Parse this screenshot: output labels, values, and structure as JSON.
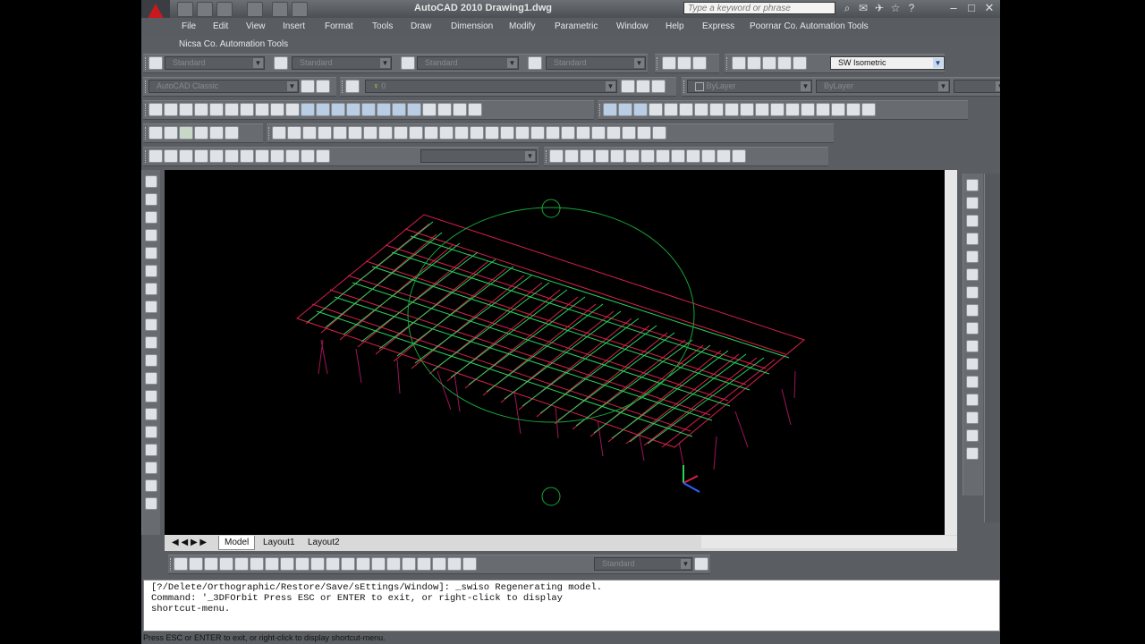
{
  "titlebar": {
    "title": "AutoCAD 2010    Drawing1.dwg",
    "search_placeholder": "Type a keyword or phrase"
  },
  "menubar": {
    "items": [
      "File",
      "Edit",
      "View",
      "Insert",
      "Format",
      "Tools",
      "Draw",
      "Dimension",
      "Modify",
      "Parametric",
      "Window",
      "Help",
      "Express",
      "Poornar Co. Automation Tools"
    ],
    "second_row": "Nicsa Co. Automation Tools"
  },
  "styles_toolbar": {
    "text_style": "Standard",
    "dim_style": "Standard",
    "table_style": "Standard",
    "mleader_style": "Standard"
  },
  "view_toolbar": {
    "view_combo": "SW Isometric"
  },
  "workspace": {
    "name": "AutoCAD Classic"
  },
  "layers": {
    "current_layer": "0"
  },
  "properties": {
    "color": "ByLayer",
    "linetype": "ByLayer"
  },
  "tabs": [
    "Model",
    "Layout1",
    "Layout2"
  ],
  "dim_toolbar": {
    "dim_style_combo": "Standard"
  },
  "command": {
    "line1": "[?/Delete/Orthographic/Restore/Save/sEttings/Window]: _swiso Regenerating model.",
    "line2": "Command: '_3DFOrbit Press ESC or ENTER to exit, or right-click to display",
    "line3": "shortcut-menu."
  },
  "status": {
    "text": "Press ESC or ENTER to exit, or right-click to display shortcut-menu."
  },
  "colors": {
    "orbit_circle": "#17a63a",
    "truss_red": "#d8204a",
    "truss_green": "#29d35a",
    "column_magenta": "#a0145a"
  }
}
